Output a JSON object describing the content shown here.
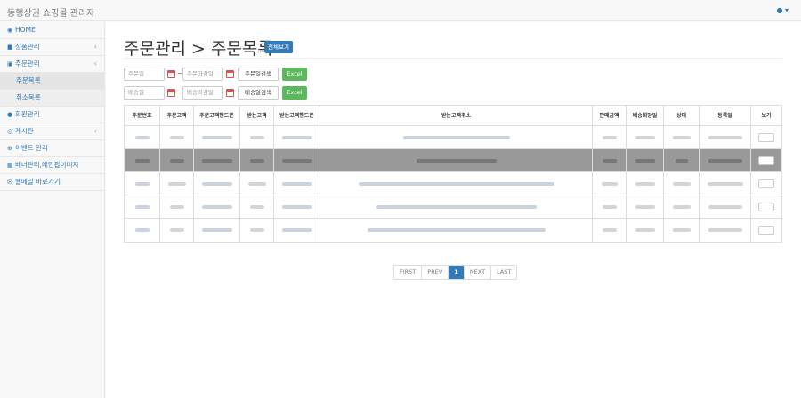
{
  "app": {
    "title": "동행상권 쇼핑몰 관리자",
    "user_icon": "user-icon"
  },
  "sidebar": {
    "items": [
      {
        "label": "HOME",
        "icon": "dashboard-icon"
      },
      {
        "label": "상품관리",
        "icon": "gift-icon"
      },
      {
        "label": "주문관리",
        "icon": "cart-icon"
      },
      {
        "label": "주문목록",
        "sub": true
      },
      {
        "label": "취소목록",
        "sub": true
      },
      {
        "label": "회원관리",
        "icon": "users-icon"
      },
      {
        "label": "게시판",
        "icon": "compass-icon"
      },
      {
        "label": "이벤트 관리",
        "icon": "plus-circle-icon"
      },
      {
        "label": "배너관리,메인팝이미지",
        "icon": "picture-icon"
      },
      {
        "label": "웹메일 바로가기",
        "icon": "envelope-icon"
      }
    ]
  },
  "main": {
    "title": "주문관리 > 주문목록",
    "view_all": "전체보기",
    "filters": {
      "order_start_placeholder": "주문일",
      "order_end_placeholder": "주문마감일",
      "order_search": "주문일검색",
      "ship_start_placeholder": "배송일",
      "ship_end_placeholder": "배송마감일",
      "ship_search": "배송일검색",
      "excel": "Excel"
    },
    "table": {
      "headers": [
        "주문번호",
        "주문고객",
        "주문고객핸드폰",
        "받는고객",
        "받는고객핸드폰",
        "받는고객주소",
        "판매금액",
        "배송희망일",
        "상태",
        "등록일",
        "보기"
      ]
    },
    "pagination": {
      "first": "FIRST",
      "prev": "PREV",
      "current": "1",
      "next": "NEXT",
      "last": "LAST"
    }
  }
}
